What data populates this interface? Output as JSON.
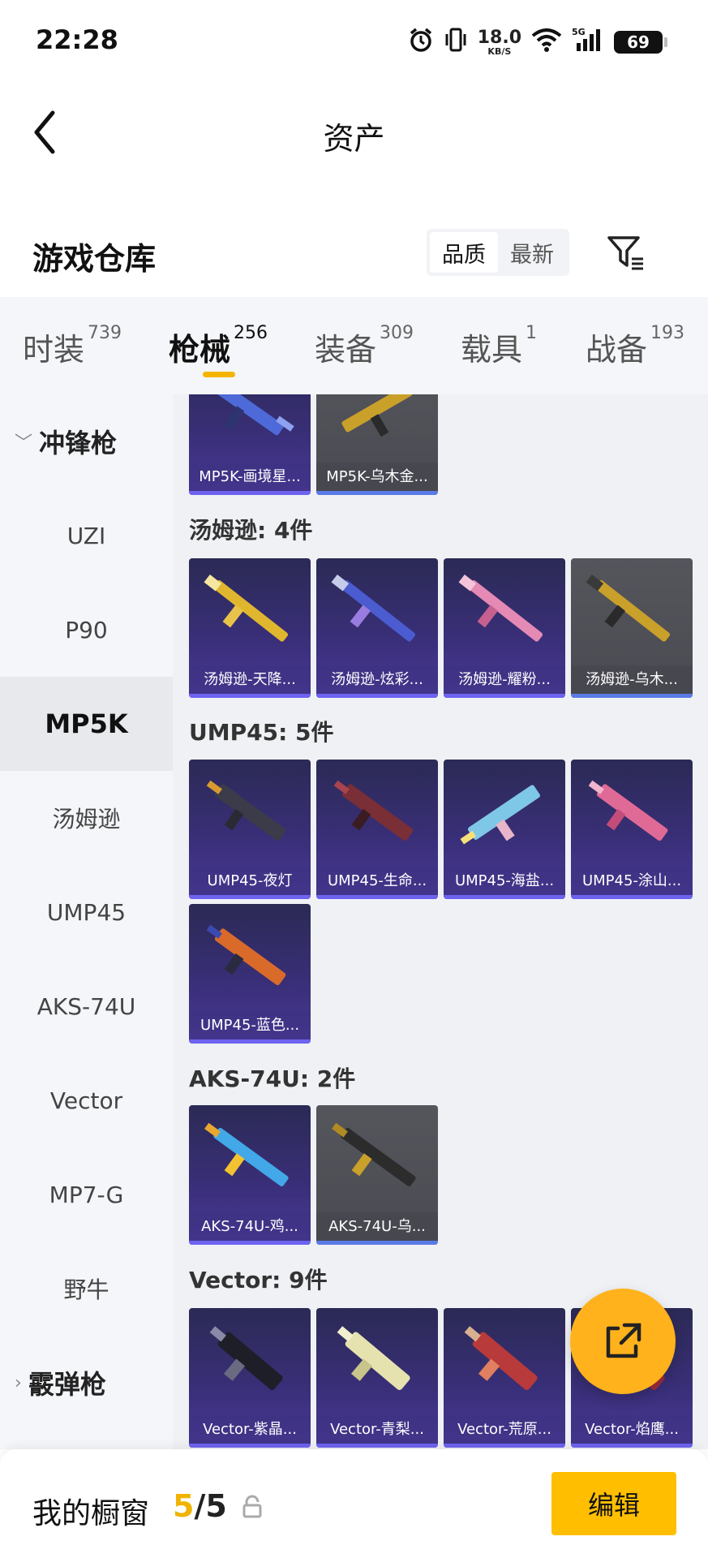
{
  "status": {
    "time": "22:28",
    "net_speed": "18.0",
    "net_unit": "KB/S",
    "network": "5G",
    "battery": "69"
  },
  "header": {
    "title": "资产"
  },
  "warehouse": {
    "title": "游戏仓库",
    "sort_options": [
      "品质",
      "最新"
    ]
  },
  "tabs": [
    {
      "label": "时装",
      "count": "739"
    },
    {
      "label": "枪械",
      "count": "256"
    },
    {
      "label": "装备",
      "count": "309"
    },
    {
      "label": "载具",
      "count": "1"
    },
    {
      "label": "战备",
      "count": "193"
    }
  ],
  "sidebar": {
    "group1": "冲锋枪",
    "items": [
      "UZI",
      "P90",
      "MP5K",
      "汤姆逊",
      "UMP45",
      "AKS-74U",
      "Vector",
      "MP7-G",
      "野牛"
    ],
    "group2": "霰弹枪"
  },
  "sections": {
    "mp5k": {
      "items": [
        "MP5K-画境星...",
        "MP5K-乌木金..."
      ]
    },
    "thompson": {
      "title": "汤姆逊: 4件",
      "items": [
        "汤姆逊-天降...",
        "汤姆逊-炫彩...",
        "汤姆逊-耀粉...",
        "汤姆逊-乌木..."
      ]
    },
    "ump45": {
      "title": "UMP45: 5件",
      "items": [
        "UMP45-夜灯",
        "UMP45-生命...",
        "UMP45-海盐...",
        "UMP45-涂山...",
        "UMP45-蓝色..."
      ]
    },
    "aks74u": {
      "title": "AKS-74U: 2件",
      "items": [
        "AKS-74U-鸡...",
        "AKS-74U-乌..."
      ]
    },
    "vector": {
      "title": "Vector: 9件",
      "items": [
        "Vector-紫晶...",
        "Vector-青梨...",
        "Vector-荒原...",
        "Vector-焰鹰..."
      ]
    }
  },
  "bottom": {
    "title": "我的橱窗",
    "current": "5",
    "total": "5",
    "edit_label": "编辑"
  },
  "colors": {
    "accent": "#ffbf00",
    "card_purple": "#3a2f7a",
    "card_grey": "#4d4d55"
  }
}
